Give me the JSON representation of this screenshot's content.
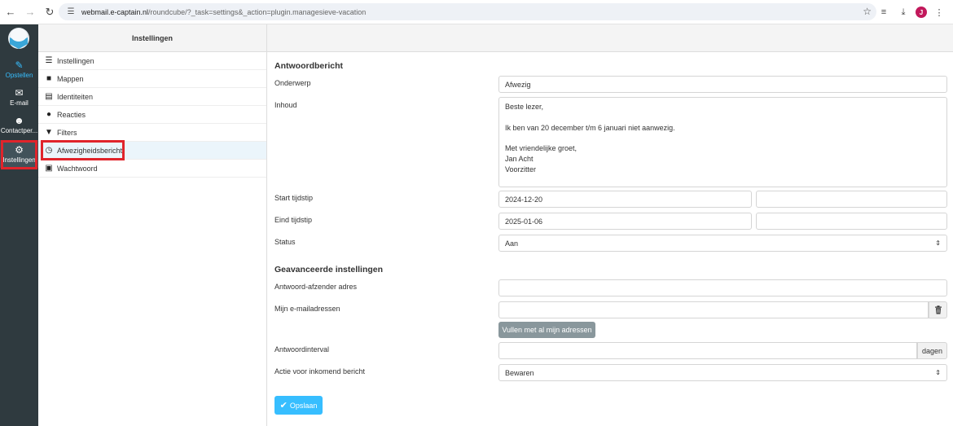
{
  "browser": {
    "url_host": "webmail.e-captain.nl",
    "url_path": "/roundcube/?_task=settings&_action=plugin.managesieve-vacation",
    "profile_initial": "J"
  },
  "rail": {
    "items": [
      {
        "label": "Opstellen"
      },
      {
        "label": "E-mail"
      },
      {
        "label": "Contactper..."
      },
      {
        "label": "Instellingen"
      }
    ]
  },
  "settings_list": {
    "header": "Instellingen",
    "items": [
      {
        "label": "Instellingen",
        "icon": "sliders-icon"
      },
      {
        "label": "Mappen",
        "icon": "folder-icon"
      },
      {
        "label": "Identiteiten",
        "icon": "id-card-icon"
      },
      {
        "label": "Reacties",
        "icon": "comment-icon"
      },
      {
        "label": "Filters",
        "icon": "filter-icon"
      },
      {
        "label": "Afwezigheidsbericht",
        "icon": "clock-icon"
      },
      {
        "label": "Wachtwoord",
        "icon": "lock-icon"
      }
    ]
  },
  "form": {
    "section_reply": "Antwoordbericht",
    "subject_label": "Onderwerp",
    "subject_value": "Afwezig",
    "body_label": "Inhoud",
    "body_lines": [
      "Beste lezer,",
      "",
      "Ik ben van 20 december t/m 6 januari niet aanwezig.",
      "",
      "Met vriendelijke groet,",
      "Jan Acht",
      "Voorzitter"
    ],
    "start_label": "Start tijdstip",
    "start_date": "2024-12-20",
    "start_time": "",
    "end_label": "Eind tijdstip",
    "end_date": "2025-01-06",
    "end_time": "",
    "status_label": "Status",
    "status_value": "Aan",
    "section_advanced": "Geavanceerde instellingen",
    "sender_label": "Antwoord-afzender adres",
    "sender_value": "",
    "my_addresses_label": "Mijn e-mailadressen",
    "my_addresses_value": "",
    "fill_button": "Vullen met al mijn adressen",
    "interval_label": "Antwoordinterval",
    "interval_value": "",
    "interval_unit": "dagen",
    "action_label": "Actie voor inkomend bericht",
    "action_value": "Bewaren",
    "save_button": "Opslaan"
  },
  "colors": {
    "accent": "#37beff",
    "rail_bg": "#2f3a3f",
    "highlight": "#e0242b"
  }
}
